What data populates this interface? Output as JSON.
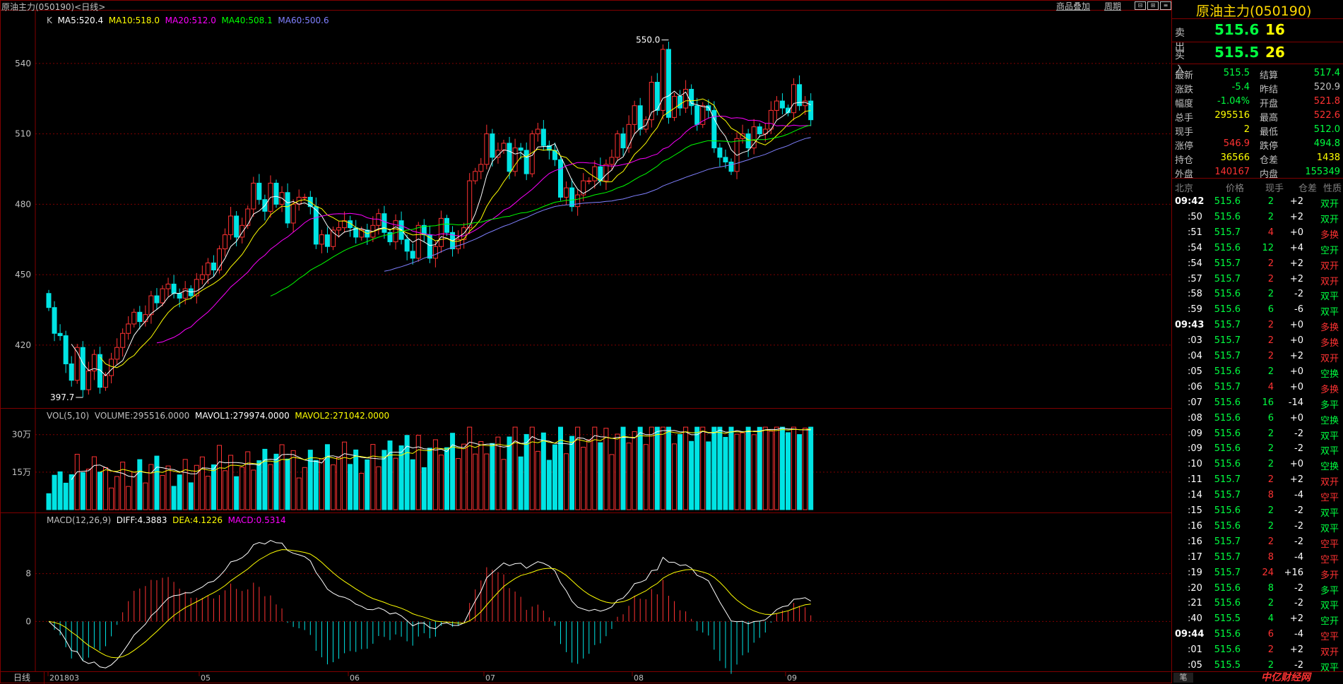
{
  "header": {
    "title": "原油主力(050190)<日线>",
    "link_overlay": "商品叠加",
    "link_period": "周期"
  },
  "kline_legend": {
    "prefix": "K",
    "ma5": "MA5:520.4",
    "ma10": "MA10:518.0",
    "ma20": "MA20:512.0",
    "ma40": "MA40:508.1",
    "ma60": "MA60:500.6"
  },
  "kline_axis": [
    "540",
    "510",
    "480",
    "450",
    "420"
  ],
  "kline_marks": {
    "high": "550.0",
    "low": "397.7"
  },
  "vol_legend": {
    "prefix": "VOL(5,10)",
    "volume": "VOLUME:295516.0000",
    "mavol1": "MAVOL1:279974.0000",
    "mavol2": "MAVOL2:271042.0000"
  },
  "vol_axis": [
    "30万",
    "15万"
  ],
  "macd_legend": {
    "prefix": "MACD(12,26,9)",
    "diff": "DIFF:4.3883",
    "dea": "DEA:4.1226",
    "macd": "MACD:0.5314"
  },
  "macd_axis": [
    "8",
    "0"
  ],
  "x_axis": {
    "period_tab": "日线",
    "labels": [
      "201803",
      "05",
      "06",
      "07",
      "08",
      "09"
    ]
  },
  "colors": {
    "up": "#ff3232",
    "down": "#00e4e4",
    "ma5": "#ffffff",
    "ma10": "#ffff00",
    "ma20": "#ff00ff",
    "ma40": "#00ff00",
    "ma60": "#8080ff",
    "grid": "#800000"
  },
  "quote_panel": {
    "title": "原油主力(050190)",
    "sell_label": "卖出",
    "sell_price": "515.6",
    "sell_vol": "16",
    "buy_label": "买入",
    "buy_price": "515.5",
    "buy_vol": "26",
    "stats": [
      {
        "l1": "最新",
        "v1": "515.5",
        "c1": "#00ff40",
        "l2": "结算",
        "v2": "517.4",
        "c2": "#00ff40"
      },
      {
        "l1": "涨跌",
        "v1": "-5.4",
        "c1": "#00ff40",
        "l2": "昨结",
        "v2": "520.9",
        "c2": "#c0c0c0"
      },
      {
        "l1": "幅度",
        "v1": "-1.04%",
        "c1": "#00ff40",
        "l2": "开盘",
        "v2": "521.8",
        "c2": "#ff3232"
      },
      {
        "l1": "总手",
        "v1": "295516",
        "c1": "#ffff00",
        "l2": "最高",
        "v2": "522.6",
        "c2": "#ff3232"
      },
      {
        "l1": "现手",
        "v1": "2",
        "c1": "#ffff00",
        "l2": "最低",
        "v2": "512.0",
        "c2": "#00ff40"
      },
      {
        "l1": "涨停",
        "v1": "546.9",
        "c1": "#ff3232",
        "l2": "跌停",
        "v2": "494.8",
        "c2": "#00ff40"
      },
      {
        "l1": "持仓",
        "v1": "36566",
        "c1": "#ffff00",
        "l2": "仓差",
        "v2": "1438",
        "c2": "#ffff00"
      },
      {
        "l1": "外盘",
        "v1": "140167",
        "c1": "#ff3232",
        "l2": "内盘",
        "v2": "155349",
        "c2": "#00ff40"
      }
    ],
    "tick_headers": [
      "北京",
      "价格",
      "现手",
      "仓差",
      "性质"
    ],
    "ticks": [
      {
        "t": "09:42",
        "p": "515.6",
        "v": "2",
        "d": "+2",
        "n": "双开",
        "major": true,
        "pc": "#00ff40",
        "nc": "#00ff40"
      },
      {
        "t": ":50",
        "p": "515.6",
        "v": "2",
        "d": "+2",
        "n": "双开",
        "major": false,
        "pc": "#00ff40",
        "nc": "#00ff40"
      },
      {
        "t": ":51",
        "p": "515.7",
        "v": "4",
        "d": "+0",
        "n": "多换",
        "major": false,
        "pc": "#00ff40",
        "nc": "#ff3232"
      },
      {
        "t": ":54",
        "p": "515.6",
        "v": "12",
        "d": "+4",
        "n": "空开",
        "major": false,
        "pc": "#00ff40",
        "nc": "#00ff40"
      },
      {
        "t": ":54",
        "p": "515.7",
        "v": "2",
        "d": "+2",
        "n": "双开",
        "major": false,
        "pc": "#00ff40",
        "nc": "#ff3232"
      },
      {
        "t": ":57",
        "p": "515.7",
        "v": "2",
        "d": "+2",
        "n": "双开",
        "major": false,
        "pc": "#00ff40",
        "nc": "#ff3232"
      },
      {
        "t": ":58",
        "p": "515.6",
        "v": "2",
        "d": "-2",
        "n": "双平",
        "major": false,
        "pc": "#00ff40",
        "nc": "#00ff40"
      },
      {
        "t": ":59",
        "p": "515.6",
        "v": "6",
        "d": "-6",
        "n": "双平",
        "major": false,
        "pc": "#00ff40",
        "nc": "#00ff40"
      },
      {
        "t": "09:43",
        "p": "515.7",
        "v": "2",
        "d": "+0",
        "n": "多换",
        "major": true,
        "pc": "#00ff40",
        "nc": "#ff3232"
      },
      {
        "t": ":03",
        "p": "515.7",
        "v": "2",
        "d": "+0",
        "n": "多换",
        "major": false,
        "pc": "#00ff40",
        "nc": "#ff3232"
      },
      {
        "t": ":04",
        "p": "515.7",
        "v": "2",
        "d": "+2",
        "n": "双开",
        "major": false,
        "pc": "#00ff40",
        "nc": "#ff3232"
      },
      {
        "t": ":05",
        "p": "515.6",
        "v": "2",
        "d": "+0",
        "n": "空换",
        "major": false,
        "pc": "#00ff40",
        "nc": "#00ff40"
      },
      {
        "t": ":06",
        "p": "515.7",
        "v": "4",
        "d": "+0",
        "n": "多换",
        "major": false,
        "pc": "#00ff40",
        "nc": "#ff3232"
      },
      {
        "t": ":07",
        "p": "515.6",
        "v": "16",
        "d": "-14",
        "n": "多平",
        "major": false,
        "pc": "#00ff40",
        "nc": "#00ff40"
      },
      {
        "t": ":08",
        "p": "515.6",
        "v": "6",
        "d": "+0",
        "n": "空换",
        "major": false,
        "pc": "#00ff40",
        "nc": "#00ff40"
      },
      {
        "t": ":09",
        "p": "515.6",
        "v": "2",
        "d": "-2",
        "n": "双平",
        "major": false,
        "pc": "#00ff40",
        "nc": "#00ff40"
      },
      {
        "t": ":09",
        "p": "515.6",
        "v": "2",
        "d": "-2",
        "n": "双平",
        "major": false,
        "pc": "#00ff40",
        "nc": "#00ff40"
      },
      {
        "t": ":10",
        "p": "515.6",
        "v": "2",
        "d": "+0",
        "n": "空换",
        "major": false,
        "pc": "#00ff40",
        "nc": "#00ff40"
      },
      {
        "t": ":11",
        "p": "515.7",
        "v": "2",
        "d": "+2",
        "n": "双开",
        "major": false,
        "pc": "#00ff40",
        "nc": "#ff3232"
      },
      {
        "t": ":14",
        "p": "515.7",
        "v": "8",
        "d": "-4",
        "n": "空平",
        "major": false,
        "pc": "#00ff40",
        "nc": "#ff3232"
      },
      {
        "t": ":15",
        "p": "515.6",
        "v": "2",
        "d": "-2",
        "n": "双平",
        "major": false,
        "pc": "#00ff40",
        "nc": "#00ff40"
      },
      {
        "t": ":16",
        "p": "515.6",
        "v": "2",
        "d": "-2",
        "n": "双平",
        "major": false,
        "pc": "#00ff40",
        "nc": "#00ff40"
      },
      {
        "t": ":16",
        "p": "515.7",
        "v": "2",
        "d": "-2",
        "n": "空平",
        "major": false,
        "pc": "#00ff40",
        "nc": "#ff3232"
      },
      {
        "t": ":17",
        "p": "515.7",
        "v": "8",
        "d": "-4",
        "n": "空平",
        "major": false,
        "pc": "#00ff40",
        "nc": "#ff3232"
      },
      {
        "t": ":19",
        "p": "515.7",
        "v": "24",
        "d": "+16",
        "n": "多开",
        "major": false,
        "pc": "#00ff40",
        "nc": "#ff3232"
      },
      {
        "t": ":20",
        "p": "515.6",
        "v": "8",
        "d": "-2",
        "n": "多平",
        "major": false,
        "pc": "#00ff40",
        "nc": "#00ff40"
      },
      {
        "t": ":21",
        "p": "515.6",
        "v": "2",
        "d": "-2",
        "n": "双平",
        "major": false,
        "pc": "#00ff40",
        "nc": "#00ff40"
      },
      {
        "t": ":40",
        "p": "515.5",
        "v": "4",
        "d": "+2",
        "n": "空开",
        "major": false,
        "pc": "#00ff40",
        "nc": "#00ff40"
      },
      {
        "t": "09:44",
        "p": "515.6",
        "v": "6",
        "d": "-4",
        "n": "空平",
        "major": true,
        "pc": "#00ff40",
        "nc": "#ff3232"
      },
      {
        "t": ":01",
        "p": "515.6",
        "v": "2",
        "d": "+2",
        "n": "双开",
        "major": false,
        "pc": "#00ff40",
        "nc": "#ff3232"
      },
      {
        "t": ":05",
        "p": "515.5",
        "v": "2",
        "d": "-2",
        "n": "双平",
        "major": false,
        "pc": "#00ff40",
        "nc": "#00ff40"
      }
    ],
    "bottom_tab": "笔",
    "watermark": "中亿财经网"
  },
  "chart_data": [
    {
      "type": "candlestick",
      "title": "原油主力(050190)<日线>",
      "ylim": [
        395,
        555
      ],
      "y_ticks": [
        420,
        450,
        480,
        510,
        540
      ],
      "x_ticks": [
        "201803",
        "05",
        "06",
        "07",
        "08",
        "09"
      ],
      "annotations": [
        {
          "label": "550.0",
          "value": 550.0
        },
        {
          "label": "397.7",
          "value": 397.7
        }
      ],
      "closes": [
        436,
        425,
        424,
        412,
        405,
        419,
        401,
        409,
        416,
        402,
        407,
        414,
        419,
        425,
        429,
        434,
        430,
        433,
        441,
        438,
        444,
        446,
        442,
        440,
        444,
        441,
        448,
        450,
        455,
        452,
        461,
        467,
        475,
        466,
        471,
        478,
        489,
        482,
        477,
        489,
        480,
        485,
        472,
        480,
        483,
        483,
        479,
        463,
        467,
        462,
        469,
        470,
        473,
        470,
        466,
        469,
        466,
        471,
        476,
        468,
        464,
        473,
        465,
        460,
        457,
        471,
        467,
        457,
        462,
        474,
        468,
        461,
        465,
        470,
        490,
        494,
        497,
        510,
        500,
        503,
        506,
        494,
        504,
        503,
        493,
        510,
        512,
        505,
        503,
        499,
        483,
        487,
        479,
        484,
        490,
        490,
        496,
        490,
        497,
        500,
        510,
        504,
        514,
        522,
        512,
        516,
        532,
        520,
        546,
        517,
        526,
        521,
        529,
        522,
        514,
        522,
        520,
        504,
        500,
        498,
        494,
        508,
        510,
        504,
        513,
        510,
        512,
        520,
        524,
        521,
        519,
        531,
        522,
        524,
        516
      ],
      "ma_series": [
        {
          "name": "MA5",
          "last": 520.4
        },
        {
          "name": "MA10",
          "last": 518.0
        },
        {
          "name": "MA20",
          "last": 512.0
        },
        {
          "name": "MA40",
          "last": 508.1
        },
        {
          "name": "MA60",
          "last": 500.6
        }
      ]
    },
    {
      "type": "bar",
      "title": "VOL(5,10)",
      "ylim": [
        0,
        350000
      ],
      "y_ticks": [
        150000,
        300000
      ],
      "y_tick_labels": [
        "15万",
        "30万"
      ],
      "last_volume": 295516,
      "series": [
        {
          "name": "MAVOL1",
          "last": 279974
        },
        {
          "name": "MAVOL2",
          "last": 271042
        }
      ]
    },
    {
      "type": "bar",
      "title": "MACD(12,26,9)",
      "ylim": [
        -8,
        16
      ],
      "y_ticks": [
        0,
        8
      ],
      "series": [
        {
          "name": "DIFF",
          "last": 4.3883
        },
        {
          "name": "DEA",
          "last": 4.1226
        },
        {
          "name": "MACD",
          "last": 0.5314
        }
      ]
    }
  ]
}
